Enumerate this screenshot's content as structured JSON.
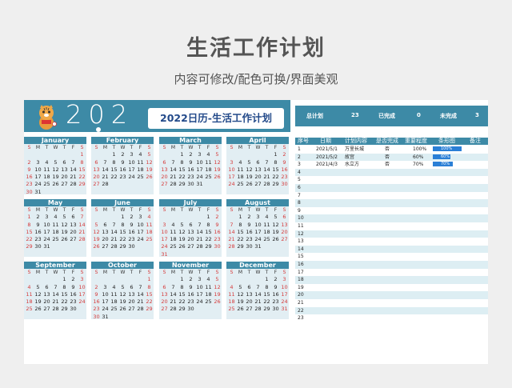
{
  "page": {
    "title": "生活工作计划",
    "subtitle": "内容可修改/配色可换/界面美观"
  },
  "calendar": {
    "year_text": "202",
    "title": "2022日历-生活工作计划",
    "weekday_headers": [
      "S",
      "M",
      "T",
      "W",
      "T",
      "F",
      "S"
    ],
    "months": [
      {
        "name": "January",
        "offset": 6,
        "days": 31
      },
      {
        "name": "February",
        "offset": 2,
        "days": 28
      },
      {
        "name": "March",
        "offset": 2,
        "days": 31
      },
      {
        "name": "April",
        "offset": 5,
        "days": 30
      },
      {
        "name": "May",
        "offset": 0,
        "days": 31
      },
      {
        "name": "June",
        "offset": 3,
        "days": 30
      },
      {
        "name": "July",
        "offset": 5,
        "days": 31
      },
      {
        "name": "August",
        "offset": 1,
        "days": 31
      },
      {
        "name": "September",
        "offset": 4,
        "days": 30
      },
      {
        "name": "October",
        "offset": 6,
        "days": 31
      },
      {
        "name": "November",
        "offset": 2,
        "days": 30
      },
      {
        "name": "December",
        "offset": 4,
        "days": 31
      }
    ]
  },
  "summary": {
    "total_label": "总计划",
    "total_value": "23",
    "done_label": "已完成",
    "done_value": "0",
    "undone_label": "未完成",
    "undone_value": "3"
  },
  "table": {
    "headers": [
      "序号",
      "日期",
      "计划内容",
      "是否完成",
      "重要程度",
      "条形图",
      "备注"
    ],
    "rows": [
      {
        "no": "1",
        "date": "2021/5/1",
        "content": "万里长城",
        "done": "否",
        "importance": "100%",
        "pct": 1.0,
        "bar_label": "100%"
      },
      {
        "no": "2",
        "date": "2021/5/2",
        "content": "故宫",
        "done": "否",
        "importance": "60%",
        "pct": 0.6,
        "bar_label": "60%"
      },
      {
        "no": "3",
        "date": "2021/4/3",
        "content": "水立方",
        "done": "否",
        "importance": "70%",
        "pct": 0.7,
        "bar_label": "70%"
      },
      {
        "no": "4"
      },
      {
        "no": "5"
      },
      {
        "no": "6"
      },
      {
        "no": "7"
      },
      {
        "no": "8"
      },
      {
        "no": "9"
      },
      {
        "no": "10"
      },
      {
        "no": "11"
      },
      {
        "no": "12"
      },
      {
        "no": "13"
      },
      {
        "no": "14"
      },
      {
        "no": "15"
      },
      {
        "no": "16"
      },
      {
        "no": "17"
      },
      {
        "no": "18"
      },
      {
        "no": "19"
      },
      {
        "no": "20"
      },
      {
        "no": "21"
      },
      {
        "no": "22"
      },
      {
        "no": "23"
      }
    ]
  },
  "colors": {
    "accent": "#3d8aa6",
    "light": "#e2eef3",
    "weekend": "#d63a3a",
    "bar": "#2a7fd6"
  }
}
